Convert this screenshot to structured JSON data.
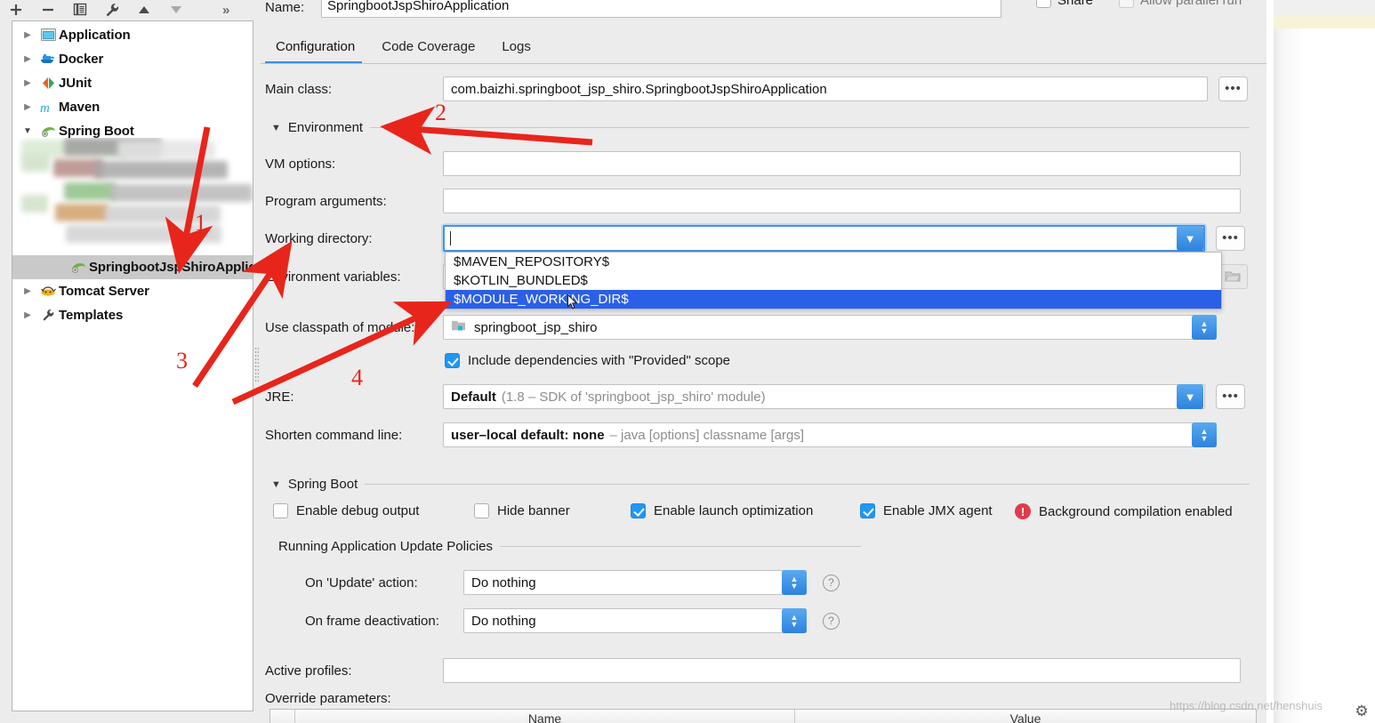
{
  "toolbar": {
    "add": "+",
    "remove": "−",
    "copy": "copy-icon",
    "edit_templates": "wrench-icon",
    "move_up": "▲",
    "move_down": "▼",
    "more": "»"
  },
  "tree": {
    "items": [
      {
        "label": "Application",
        "icon": "application-icon",
        "arrow": "right",
        "selected": false,
        "child": false
      },
      {
        "label": "Docker",
        "icon": "docker-icon",
        "arrow": "right",
        "selected": false,
        "child": false
      },
      {
        "label": "JUnit",
        "icon": "junit-icon",
        "arrow": "right",
        "selected": false,
        "child": false
      },
      {
        "label": "Maven",
        "icon": "maven-icon",
        "arrow": "right",
        "selected": false,
        "child": false
      },
      {
        "label": "Spring Boot",
        "icon": "spring-boot-icon",
        "arrow": "down",
        "selected": false,
        "child": false
      },
      {
        "label": "SpringbootJspShiroApplica",
        "icon": "spring-boot-icon",
        "arrow": "none",
        "selected": true,
        "child": true
      },
      {
        "label": "Tomcat Server",
        "icon": "tomcat-icon",
        "arrow": "right",
        "selected": false,
        "child": false
      },
      {
        "label": "Templates",
        "icon": "wrench-icon",
        "arrow": "right",
        "selected": false,
        "child": false
      }
    ]
  },
  "header": {
    "name_label": "Name:",
    "name_value": "SpringbootJspShiroApplication",
    "share_label": "Share",
    "share_checked": false,
    "parallel_label": "Allow parallel run",
    "parallel_checked": false
  },
  "tabs": [
    {
      "label": "Configuration",
      "active": true
    },
    {
      "label": "Code Coverage",
      "active": false
    },
    {
      "label": "Logs",
      "active": false
    }
  ],
  "main_class": {
    "label": "Main class:",
    "value": "com.baizhi.springboot_jsp_shiro.SpringbootJspShiroApplication",
    "browse": "•••"
  },
  "environment": {
    "section_title": "Environment",
    "vm_options_label": "VM options:",
    "vm_options_value": "",
    "program_args_label": "Program arguments:",
    "program_args_value": "",
    "working_dir_label": "Working directory:",
    "working_dir_value": "",
    "env_vars_label": "Environment variables:",
    "env_vars_value": "",
    "dropdown_options": [
      {
        "label": "$MAVEN_REPOSITORY$",
        "selected": false
      },
      {
        "label": "$KOTLIN_BUNDLED$",
        "selected": false
      },
      {
        "label": "$MODULE_WORKING_DIR$",
        "selected": true
      }
    ],
    "classpath_label": "Use classpath of module:",
    "classpath_value": "springboot_jsp_shiro",
    "include_deps_label": "Include dependencies with \"Provided\" scope",
    "include_deps_checked": true,
    "jre_label": "JRE:",
    "jre_value_bold": "Default",
    "jre_value_grey": "(1.8 – SDK of 'springboot_jsp_shiro' module)",
    "shorten_label": "Shorten command line:",
    "shorten_value_bold": "user–local default: none",
    "shorten_value_grey": "– java [options] classname [args]"
  },
  "spring_boot": {
    "section_title": "Spring Boot",
    "checkboxes": [
      {
        "label": "Enable debug output",
        "checked": false
      },
      {
        "label": "Hide banner",
        "checked": false
      },
      {
        "label": "Enable launch optimization",
        "checked": true
      },
      {
        "label": "Enable JMX agent",
        "checked": true
      }
    ],
    "warning_text": "Background compilation enabled",
    "warning_icon": "error-icon",
    "update_policies_title": "Running Application Update Policies",
    "on_update_label": "On 'Update' action:",
    "on_update_value": "Do nothing",
    "on_frame_label": "On frame deactivation:",
    "on_frame_value": "Do nothing",
    "help_icon": "?",
    "active_profiles_label": "Active profiles:",
    "active_profiles_value": "",
    "override_params_label": "Override parameters:",
    "override_table_headers": [
      "",
      "Name",
      "Value"
    ]
  },
  "annotations": {
    "numbers": [
      "1",
      "2",
      "3",
      "4"
    ]
  },
  "watermark": "https://blog.csdn.net/henshuis",
  "colors": {
    "accent_blue": "#2d82dd",
    "selection_blue": "#2a5fe8",
    "annotation_red": "#e8251b",
    "warn_red": "#e03a4e",
    "panel_grey": "#ececec"
  }
}
